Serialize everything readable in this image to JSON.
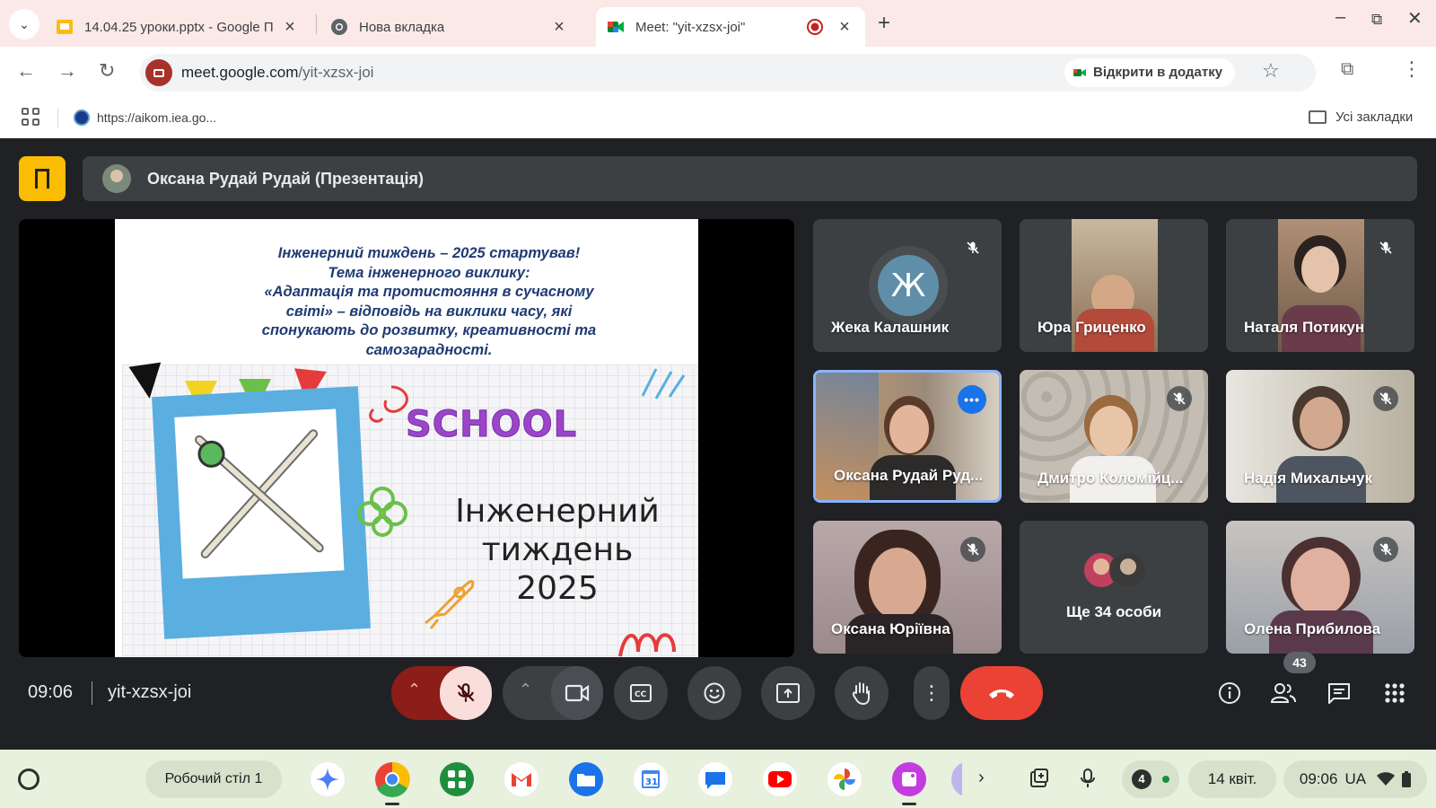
{
  "browser": {
    "tabs": [
      {
        "title": "14.04.25 уроки.pptx - Google П",
        "icon": "google-slides-icon",
        "active": false
      },
      {
        "title": "Нова вкладка",
        "icon": "chrome-icon",
        "active": false
      },
      {
        "title": "Meet: \"yit-xzsx-joi\"",
        "icon": "google-meet-icon",
        "active": true,
        "recording": true
      }
    ],
    "url_host": "meet.google.com",
    "url_path": "/yit-xzsx-joi",
    "open_in_app_label": "Відкрити в додатку",
    "bookmark": "https://aikom.iea.go...",
    "all_bookmarks_label": "Усі закладки"
  },
  "meet": {
    "presenter_banner": "Оксана Рудай Рудай (Презентація)",
    "slide": {
      "heading_lines": [
        "Інженерний тиждень – 2025 стартував!",
        "Тема інженерного виклику:",
        "«Адаптація та протистояння в сучасному",
        "світі» – відповідь на виклики часу, які",
        "спонукають до розвитку, креативності та",
        "самозарадності."
      ],
      "school_word": "SCHOOL",
      "title_lines": [
        "Інженерний",
        "тиждень",
        "2025"
      ]
    },
    "participants": [
      {
        "name": "Жека Калашник",
        "avatar_letter": "Ж",
        "muted": true,
        "video": false
      },
      {
        "name": "Юра Гриценко",
        "muted": false,
        "video": true
      },
      {
        "name": "Наталя Потикун",
        "muted": true,
        "video": true
      },
      {
        "name": "Оксана Рудай Руд...",
        "muted": false,
        "video": true,
        "speaking": true
      },
      {
        "name": "Дмитро Коломійц...",
        "muted": true,
        "video": true
      },
      {
        "name": "Надія Михальчук",
        "muted": true,
        "video": true
      },
      {
        "name": "Оксана Юріївна",
        "muted": true,
        "video": true
      },
      {
        "name": "Ще 34 особи",
        "group": true
      },
      {
        "name": "Олена Прибилова",
        "muted": true,
        "video": true
      }
    ],
    "time": "09:06",
    "meeting_code": "yit-xzsx-joi",
    "people_count": "43",
    "colors": {
      "leave": "#ea4335",
      "mic_off_bg": "#f9dedc",
      "speaking_border": "#8ab4f8",
      "accent_side": "#fbbc04"
    }
  },
  "shelf": {
    "desk_label": "Робочий стіл 1",
    "notification_count": "4",
    "date": "14 квіт.",
    "clock": "09:06",
    "input_lang": "UA"
  }
}
